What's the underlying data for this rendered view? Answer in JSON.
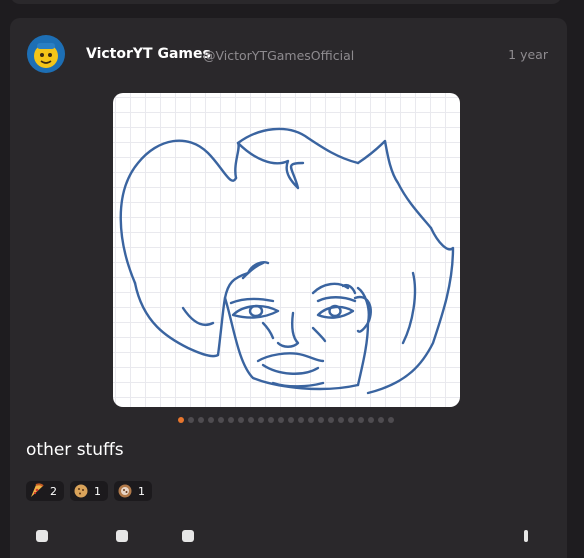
{
  "post": {
    "author_name": "VictorYT Games",
    "author_handle": "@VictorYTGamesOfficial",
    "timestamp": "1 year",
    "avatar_icon": "victoryt-avatar",
    "image": {
      "alt_icon": "sketch-drawing",
      "background": "#ffffff",
      "stroke_color": "#3a64a0"
    },
    "carousel": {
      "total": 22,
      "active_index": 0,
      "active_color": "#e8762d"
    },
    "text": "other stuffs",
    "reactions": [
      {
        "icon": "pizza-icon",
        "count": "2"
      },
      {
        "icon": "cookie-icon",
        "count": "1"
      },
      {
        "icon": "chocolate-cookie-icon",
        "count": "1"
      }
    ]
  },
  "theme": {
    "background": "#1e1c1f",
    "card": "#2a282b",
    "muted_text": "#8e8b8f"
  }
}
